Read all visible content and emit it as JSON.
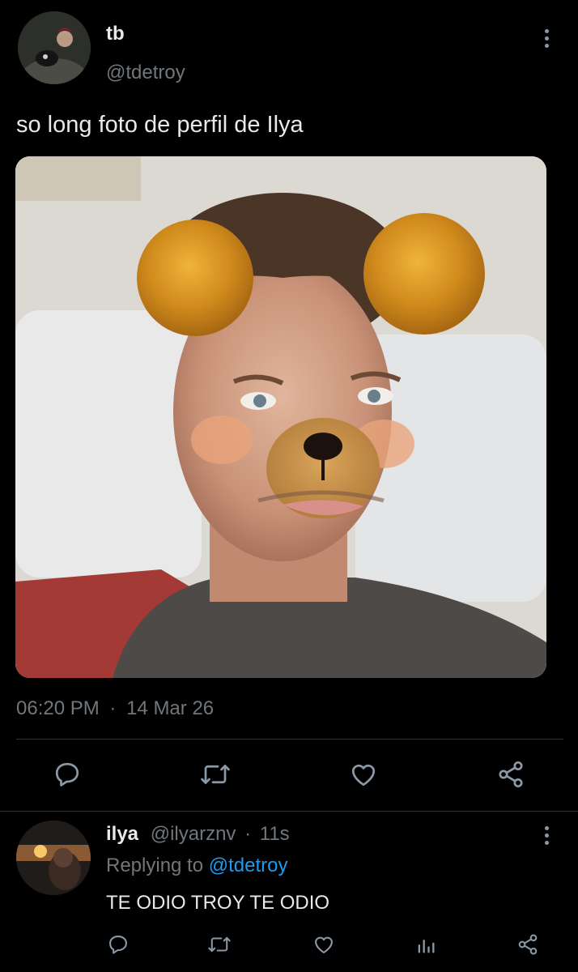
{
  "tweet": {
    "name": "tb",
    "handle": "@tdetroy",
    "text": "so long foto de perfil de Ilya",
    "time": "06:20 PM",
    "separator": "·",
    "date": "14 Mar 26"
  },
  "reply": {
    "name": "ilya",
    "handle": "@ilyarznv",
    "separator": "·",
    "age": "11s",
    "replying_prefix": "Replying to",
    "replying_to": "@tdetroy",
    "text": "TE ODIO TROY TE ODIO"
  },
  "colors": {
    "background": "#000000",
    "text": "#e7e9ea",
    "muted": "#71767b",
    "link": "#1d9bf0",
    "icon": "#8b98a5"
  },
  "icons": {
    "tweet_actions": [
      "reply-icon",
      "retweet-icon",
      "like-icon",
      "share-icon"
    ],
    "reply_actions": [
      "reply-icon",
      "retweet-icon",
      "like-icon",
      "analytics-icon",
      "share-icon"
    ]
  }
}
